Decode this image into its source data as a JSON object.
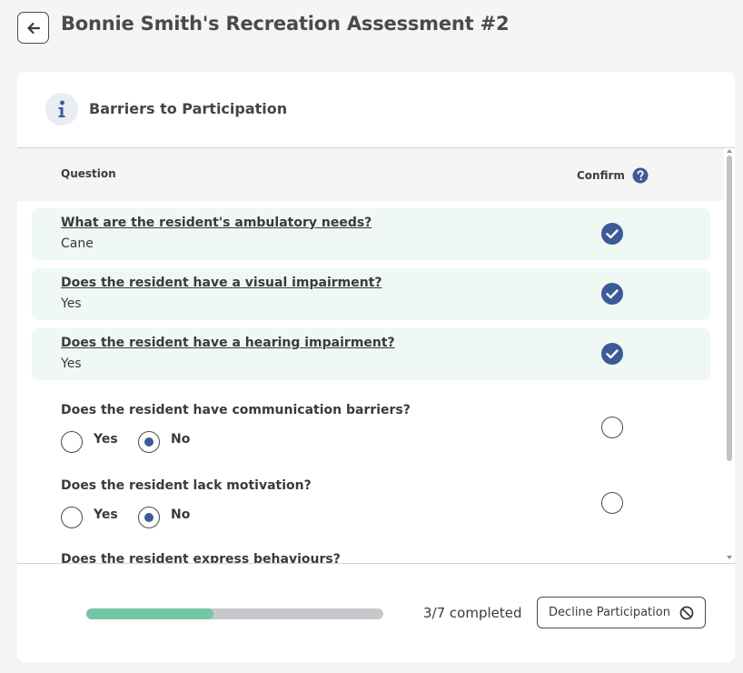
{
  "page": {
    "title": "Bonnie Smith's Recreation Assessment #2",
    "back_icon": "arrow-left-icon"
  },
  "section": {
    "title": "Barriers to Participation",
    "icon": "info-icon"
  },
  "table": {
    "col_question": "Question",
    "col_confirm": "Confirm",
    "confirm_help_icon": "question-circle-icon",
    "confirmed_rows": [
      {
        "question": "What are the resident's ambulatory needs?",
        "answer": "Cane",
        "confirmed": true
      },
      {
        "question": "Does the resident have a visual impairment?",
        "answer": "Yes",
        "confirmed": true
      },
      {
        "question": "Does the resident have a hearing impairment?",
        "answer": "Yes",
        "confirmed": true
      }
    ],
    "open_rows": [
      {
        "question": "Does the resident have communication barriers?",
        "option_yes": "Yes",
        "option_no": "No",
        "selected": "No",
        "confirmed": false
      },
      {
        "question": "Does the resident lack motivation?",
        "option_yes": "Yes",
        "option_no": "No",
        "selected": "No",
        "confirmed": false
      },
      {
        "question": "Does the resident express behaviours?"
      }
    ]
  },
  "footer": {
    "progress_completed": 3,
    "progress_total": 7,
    "progress_text": "3/7 completed",
    "decline_label": "Decline Participation",
    "decline_icon": "ban-icon"
  },
  "colors": {
    "accent_blue": "#3d5a98",
    "confirmed_row_bg": "#eff8f3",
    "progress_fill": "#74c7a5",
    "progress_track": "#c6c8cc"
  }
}
